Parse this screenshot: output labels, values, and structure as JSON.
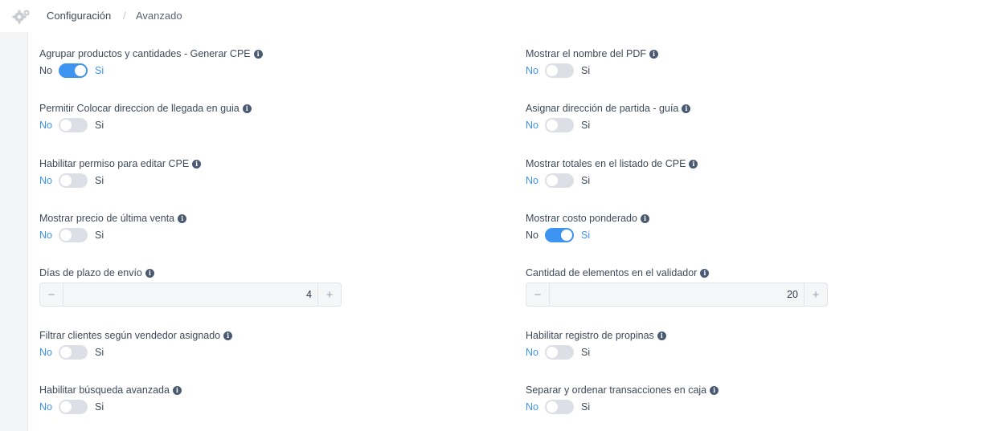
{
  "breadcrumb": {
    "icon": "gears-icon",
    "items": [
      "Configuración",
      "Avanzado"
    ],
    "separator": "/"
  },
  "settings": [
    {
      "label": "Agrupar productos y cantidades - Generar CPE",
      "type": "switch",
      "off": "No",
      "on": "Si",
      "value": true
    },
    {
      "label": "Mostrar el nombre del PDF",
      "type": "switch",
      "off": "No",
      "on": "Si",
      "value": false
    },
    {
      "label": "Permitir Colocar direccion de llegada en guia",
      "type": "switch",
      "off": "No",
      "on": "Si",
      "value": false
    },
    {
      "label": "Asignar dirección de partida - guía",
      "type": "switch",
      "off": "No",
      "on": "Si",
      "value": false
    },
    {
      "label": "Habilitar permiso para editar CPE",
      "type": "switch",
      "off": "No",
      "on": "Si",
      "value": false
    },
    {
      "label": "Mostrar totales en el listado de CPE",
      "type": "switch",
      "off": "No",
      "on": "Si",
      "value": false
    },
    {
      "label": "Mostrar precio de última venta",
      "type": "switch",
      "off": "No",
      "on": "Si",
      "value": false
    },
    {
      "label": "Mostrar costo ponderado",
      "type": "switch",
      "off": "No",
      "on": "Si",
      "value": true
    },
    {
      "label": "Días de plazo de envío",
      "type": "number",
      "value": "4"
    },
    {
      "label": "Cantidad de elementos en el validador",
      "type": "number",
      "value": "20"
    },
    {
      "label": "Filtrar clientes según vendedor asignado",
      "type": "switch",
      "off": "No",
      "on": "Si",
      "value": false
    },
    {
      "label": "Habilitar registro de propinas",
      "type": "switch",
      "off": "No",
      "on": "Si",
      "value": false
    },
    {
      "label": "Habilitar búsqueda avanzada",
      "type": "switch",
      "off": "No",
      "on": "Si",
      "value": false
    },
    {
      "label": "Separar y ordenar transacciones en caja",
      "type": "switch",
      "off": "No",
      "on": "Si",
      "value": false
    }
  ],
  "colors": {
    "accent": "#3d93f0",
    "track_off": "#dcdfe6",
    "text": "#3f4a59"
  },
  "stepper_symbols": {
    "minus": "−",
    "plus": "+"
  }
}
